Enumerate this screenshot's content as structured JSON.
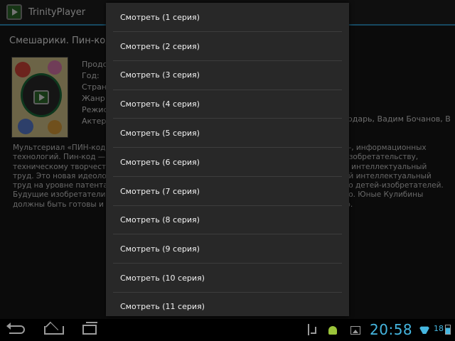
{
  "app": {
    "title": "TrinityPlayer",
    "accent_color": "#2f93c2"
  },
  "content": {
    "series_title": "Смешарики. Пин-код",
    "meta_labels": [
      "Продо",
      "Год:",
      "Страна",
      "Жанр:",
      "Режисс",
      "Актеры"
    ],
    "actors_tail": "ардарь, Вадим Бочанов, В",
    "description_left": [
      "Мультсериал «ПИН-код",
      "технологий. Пин-код — э",
      "техническому творчеств",
      "труд. Это новая идеолог",
      "труд на уровне патента и",
      "Будущие изобретатели д",
      "должны быть готовы и к"
    ],
    "description_right": [
      "о-, информационных",
      "изобретательству,",
      "и интеллектуальный",
      "ой интеллектуальный",
      "во детей-изобретателей.",
      "во. Юные Кулибины",
      "ю."
    ]
  },
  "dialog": {
    "items": [
      "Смотреть (1 серия)",
      "Смотреть (2 серия)",
      "Смотреть (3 серия)",
      "Смотреть (4 серия)",
      "Смотреть (5 серия)",
      "Смотреть (6 серия)",
      "Смотреть (7 серия)",
      "Смотреть (8 серия)",
      "Смотреть (9 серия)",
      "Смотреть (10 серия)",
      "Смотреть (11 серия)"
    ]
  },
  "system_bar": {
    "clock": "20:58",
    "battery_text": "18",
    "clock_color": "#45b6e0",
    "icons": [
      "back-icon",
      "home-icon",
      "recents-icon",
      "usb-debug-icon",
      "android-icon",
      "picture-icon",
      "wifi-icon",
      "battery-icon"
    ]
  }
}
